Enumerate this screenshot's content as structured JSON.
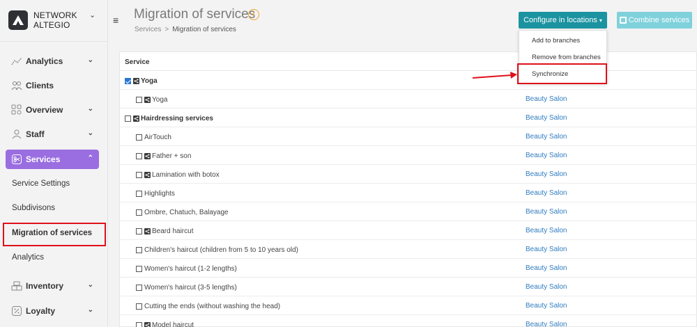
{
  "brand": {
    "name_line1": "NETWORK",
    "name_line2": "ALTEGIO"
  },
  "sidebar": {
    "items": [
      {
        "label": "Analytics",
        "icon": "analytics-icon"
      },
      {
        "label": "Clients",
        "icon": "clients-icon"
      },
      {
        "label": "Overview",
        "icon": "overview-icon"
      },
      {
        "label": "Staff",
        "icon": "staff-icon"
      },
      {
        "label": "Services",
        "icon": "services-icon"
      },
      {
        "label": "Inventory",
        "icon": "inventory-icon"
      },
      {
        "label": "Loyalty",
        "icon": "loyalty-icon"
      }
    ],
    "services_sub": [
      "Service Settings",
      "Subdivisons",
      "Migration of services",
      "Analytics"
    ]
  },
  "header": {
    "title": "Migration of services",
    "info": "i",
    "breadcrumb": {
      "root": "Services",
      "sep": ">",
      "current": "Migration of services"
    },
    "configure_label": "Configure in locations",
    "combine_label": "Combine services"
  },
  "dropdown": {
    "items": [
      "Add to branches",
      "Remove from branches",
      "Synchronize"
    ]
  },
  "table": {
    "header": "Service",
    "rows": [
      {
        "label": "Yoga",
        "group": true,
        "checked": true,
        "shared": true,
        "location": ""
      },
      {
        "label": "Yoga",
        "group": false,
        "checked": false,
        "shared": true,
        "location": "Beauty Salon"
      },
      {
        "label": "Hairdressing services",
        "group": true,
        "checked": false,
        "shared": true,
        "location": "Beauty Salon"
      },
      {
        "label": "AirTouch",
        "group": false,
        "checked": false,
        "shared": false,
        "location": "Beauty Salon"
      },
      {
        "label": "Father + son",
        "group": false,
        "checked": false,
        "shared": true,
        "location": "Beauty Salon"
      },
      {
        "label": "Lamination with botox",
        "group": false,
        "checked": false,
        "shared": true,
        "location": "Beauty Salon"
      },
      {
        "label": "Highlights",
        "group": false,
        "checked": false,
        "shared": false,
        "location": "Beauty Salon"
      },
      {
        "label": "Ombre, Chatuch, Balayage",
        "group": false,
        "checked": false,
        "shared": false,
        "location": "Beauty Salon"
      },
      {
        "label": "Beard haircut",
        "group": false,
        "checked": false,
        "shared": true,
        "location": "Beauty Salon"
      },
      {
        "label": "Children's haircut (children from 5 to 10 years old)",
        "group": false,
        "checked": false,
        "shared": false,
        "location": "Beauty Salon"
      },
      {
        "label": "Women's haircut (1-2 lengths)",
        "group": false,
        "checked": false,
        "shared": false,
        "location": "Beauty Salon"
      },
      {
        "label": "Women's haircut (3-5 lengths)",
        "group": false,
        "checked": false,
        "shared": false,
        "location": "Beauty Salon"
      },
      {
        "label": "Cutting the ends (without washing the head)",
        "group": false,
        "checked": false,
        "shared": false,
        "location": "Beauty Salon"
      },
      {
        "label": "Model haircut",
        "group": false,
        "checked": false,
        "shared": true,
        "location": "Beauty Salon"
      }
    ]
  },
  "colors": {
    "accent": "#9a6ee0",
    "primary_button": "#1b93a0",
    "secondary_button": "#7fd1dc",
    "link": "#2f7cc0",
    "highlight": "#e0101a"
  }
}
